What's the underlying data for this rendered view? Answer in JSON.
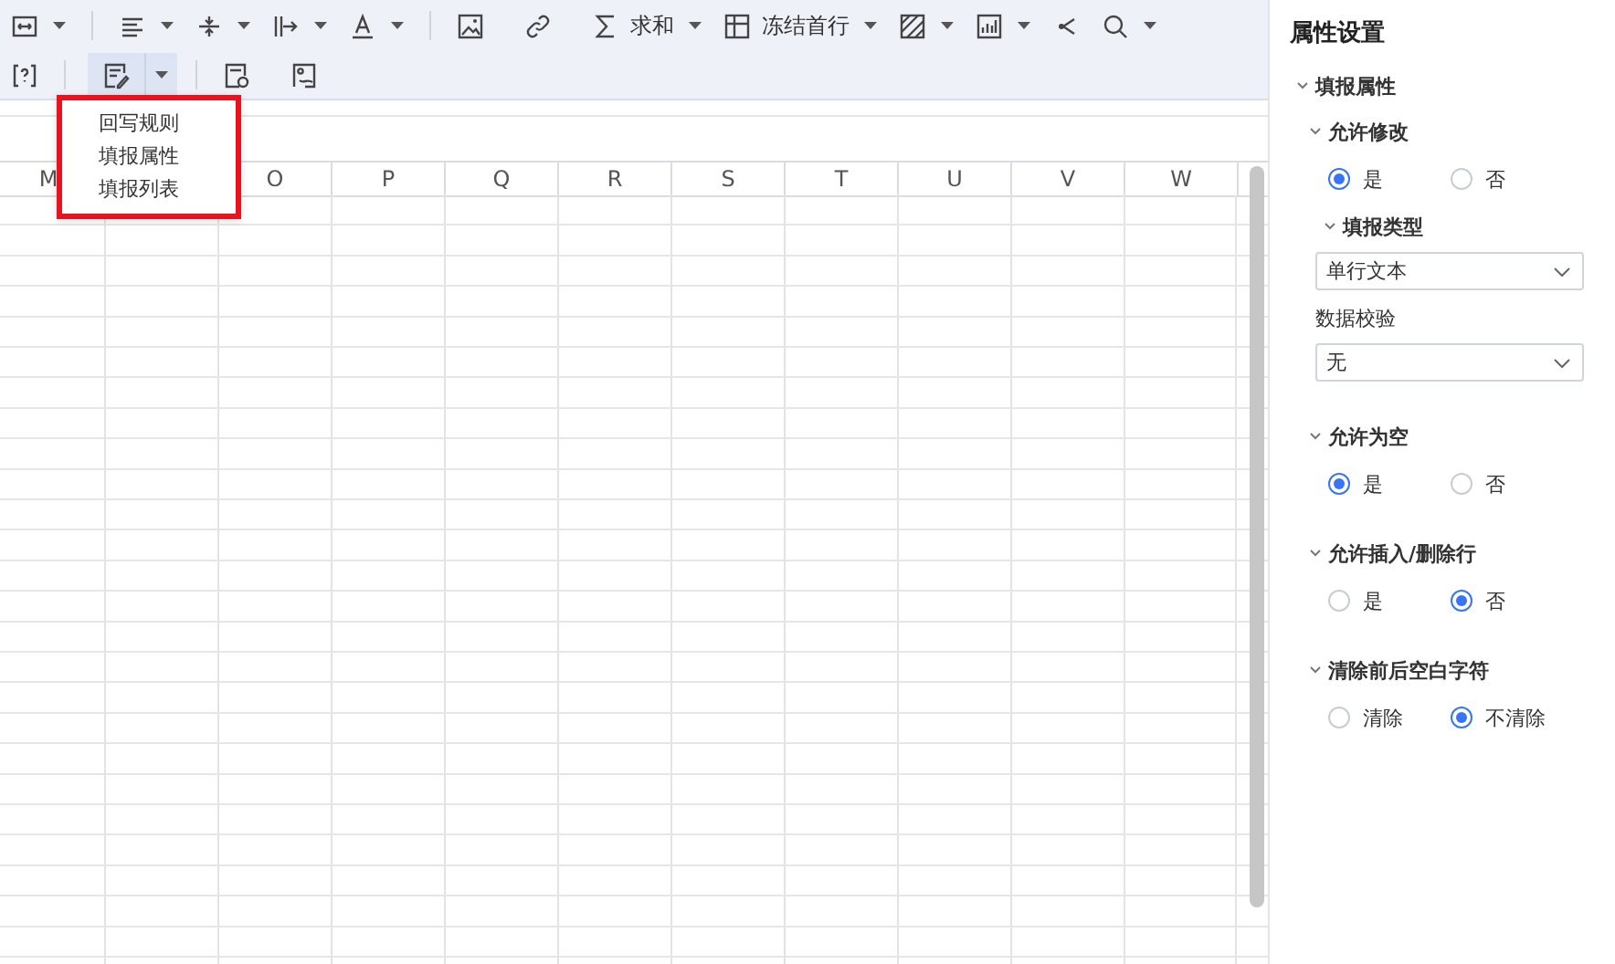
{
  "toolbar": {
    "sum_label": "求和",
    "freeze_label": "冻结首行",
    "fill_menu": {
      "open": true,
      "items": [
        {
          "label": "回写规则"
        },
        {
          "label": "填报属性"
        },
        {
          "label": "填报列表"
        }
      ]
    }
  },
  "sheet": {
    "columns": [
      "M",
      null,
      "O",
      "P",
      "Q",
      "R",
      "S",
      "T",
      "U",
      "V",
      "W"
    ]
  },
  "panel": {
    "title": "属性设置",
    "section": {
      "label": "填报属性",
      "expanded": true,
      "groups": [
        {
          "label": "允许修改",
          "expanded": true,
          "items": [
            {
              "kind": "radio",
              "options": [
                {
                  "label": "是",
                  "selected": true
                },
                {
                  "label": "否",
                  "selected": false
                }
              ]
            },
            {
              "kind": "subgroup",
              "label": "填报类型",
              "expanded": true,
              "items": [
                {
                  "kind": "select",
                  "value": "单行文本"
                },
                {
                  "kind": "caption",
                  "text": "数据校验"
                },
                {
                  "kind": "select",
                  "value": "无"
                }
              ]
            }
          ]
        },
        {
          "label": "允许为空",
          "expanded": true,
          "items": [
            {
              "kind": "radio",
              "options": [
                {
                  "label": "是",
                  "selected": true
                },
                {
                  "label": "否",
                  "selected": false
                }
              ]
            }
          ]
        },
        {
          "label": "允许插入/删除行",
          "expanded": true,
          "items": [
            {
              "kind": "radio",
              "options": [
                {
                  "label": "是",
                  "selected": false
                },
                {
                  "label": "否",
                  "selected": true
                }
              ]
            }
          ]
        },
        {
          "label": "清除前后空白字符",
          "expanded": true,
          "items": [
            {
              "kind": "radio",
              "options": [
                {
                  "label": "清除",
                  "selected": false
                },
                {
                  "label": "不清除",
                  "selected": true
                }
              ]
            }
          ]
        }
      ]
    }
  }
}
